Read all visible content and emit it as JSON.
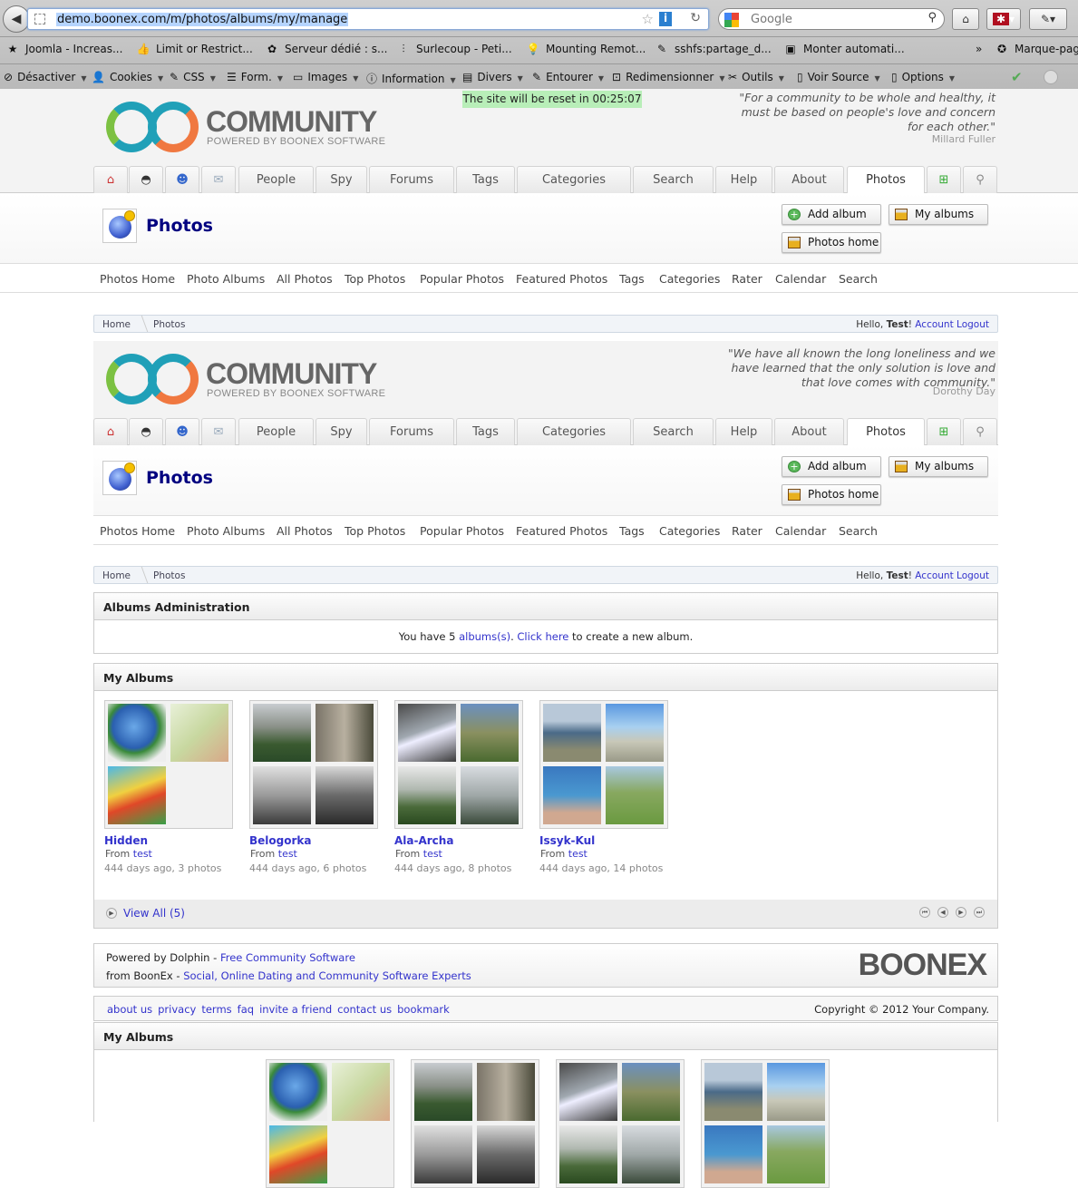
{
  "browser": {
    "url": "demo.boonex.com/m/photos/albums/my/manage",
    "search_placeholder": "Google",
    "bookmarks": [
      {
        "label": "Joomla - Increas...",
        "icon": "star-icon"
      },
      {
        "label": "Limit or Restrict...",
        "icon": "thumb-icon"
      },
      {
        "label": "Serveur dédié : s...",
        "icon": "ovh-icon"
      },
      {
        "label": "Surlecoup - Peti...",
        "icon": "surlecoup-icon"
      },
      {
        "label": "Mounting Remot...",
        "icon": "bulb-icon"
      },
      {
        "label": "sshfs:partage_d...",
        "icon": "edit-icon"
      },
      {
        "label": "Monter automati...",
        "icon": "terminal-icon"
      },
      {
        "label": "Marque-pages",
        "icon": "bookmarks-icon"
      }
    ],
    "webdev": [
      "Désactiver",
      "Cookies",
      "CSS",
      "Form.",
      "Images",
      "Information",
      "Divers",
      "Entourer",
      "Redimensionner",
      "Outils",
      "Voir Source",
      "Options"
    ]
  },
  "site": {
    "reset_notice": "The site will be reset in 00:25:07",
    "logo_title": "COMMUNITY",
    "logo_sub": "POWERED BY BOONEX SOFTWARE",
    "quotes": [
      {
        "text": "\"For a community to be whole and healthy, it must be based on people's love and concern for each other.\"",
        "author": "Millard Fuller"
      },
      {
        "text": "\"We have all known the long loneliness and we have learned that the only solution is love and that love comes with community.\"",
        "author": "Dorothy Day"
      }
    ],
    "nav": [
      "People",
      "Spy",
      "Forums",
      "Tags",
      "Categories",
      "Search",
      "Help",
      "About",
      "Photos"
    ],
    "page_title": "Photos",
    "buttons": {
      "add_album": "Add album",
      "my_albums": "My albums",
      "photos_home": "Photos home"
    },
    "submenu": [
      "Photos Home",
      "Photo Albums",
      "All Photos",
      "Top Photos",
      "Popular Photos",
      "Featured Photos",
      "Tags",
      "Categories",
      "Rater",
      "Calendar",
      "Search"
    ],
    "breadcrumb": {
      "home": "Home",
      "current": "Photos",
      "hello": "Hello, ",
      "user": "Test",
      "excl": "! ",
      "account": "Account",
      "logout": "Logout"
    }
  },
  "admin": {
    "title": "Albums Administration",
    "t1": "You have ",
    "count": "5",
    "albums_link": "albums(s)",
    "t2": ". ",
    "click_link": "Click here",
    "t3": " to create a new album."
  },
  "my_albums": {
    "title": "My Albums",
    "from": "From ",
    "albums": [
      {
        "name": "Hidden",
        "owner": "test",
        "meta": "444 days ago, 3 photos"
      },
      {
        "name": "Belogorka",
        "owner": "test",
        "meta": "444 days ago, 6 photos"
      },
      {
        "name": "Ala-Archa",
        "owner": "test",
        "meta": "444 days ago, 8 photos"
      },
      {
        "name": "Issyk-Kul",
        "owner": "test",
        "meta": "444 days ago, 14 photos"
      }
    ],
    "view_all": "View All (5)"
  },
  "footer": {
    "powered": "Powered by Dolphin - ",
    "powered_link": "Free Community Software",
    "from": "from BoonEx - ",
    "from_link": "Social, Online Dating and Community Software Experts",
    "brand": "BOONEX",
    "links": [
      "about us",
      "privacy",
      "terms",
      "faq",
      "invite a friend",
      "contact us",
      "bookmark"
    ],
    "copyright": "Copyright © 2012 Your Company."
  }
}
